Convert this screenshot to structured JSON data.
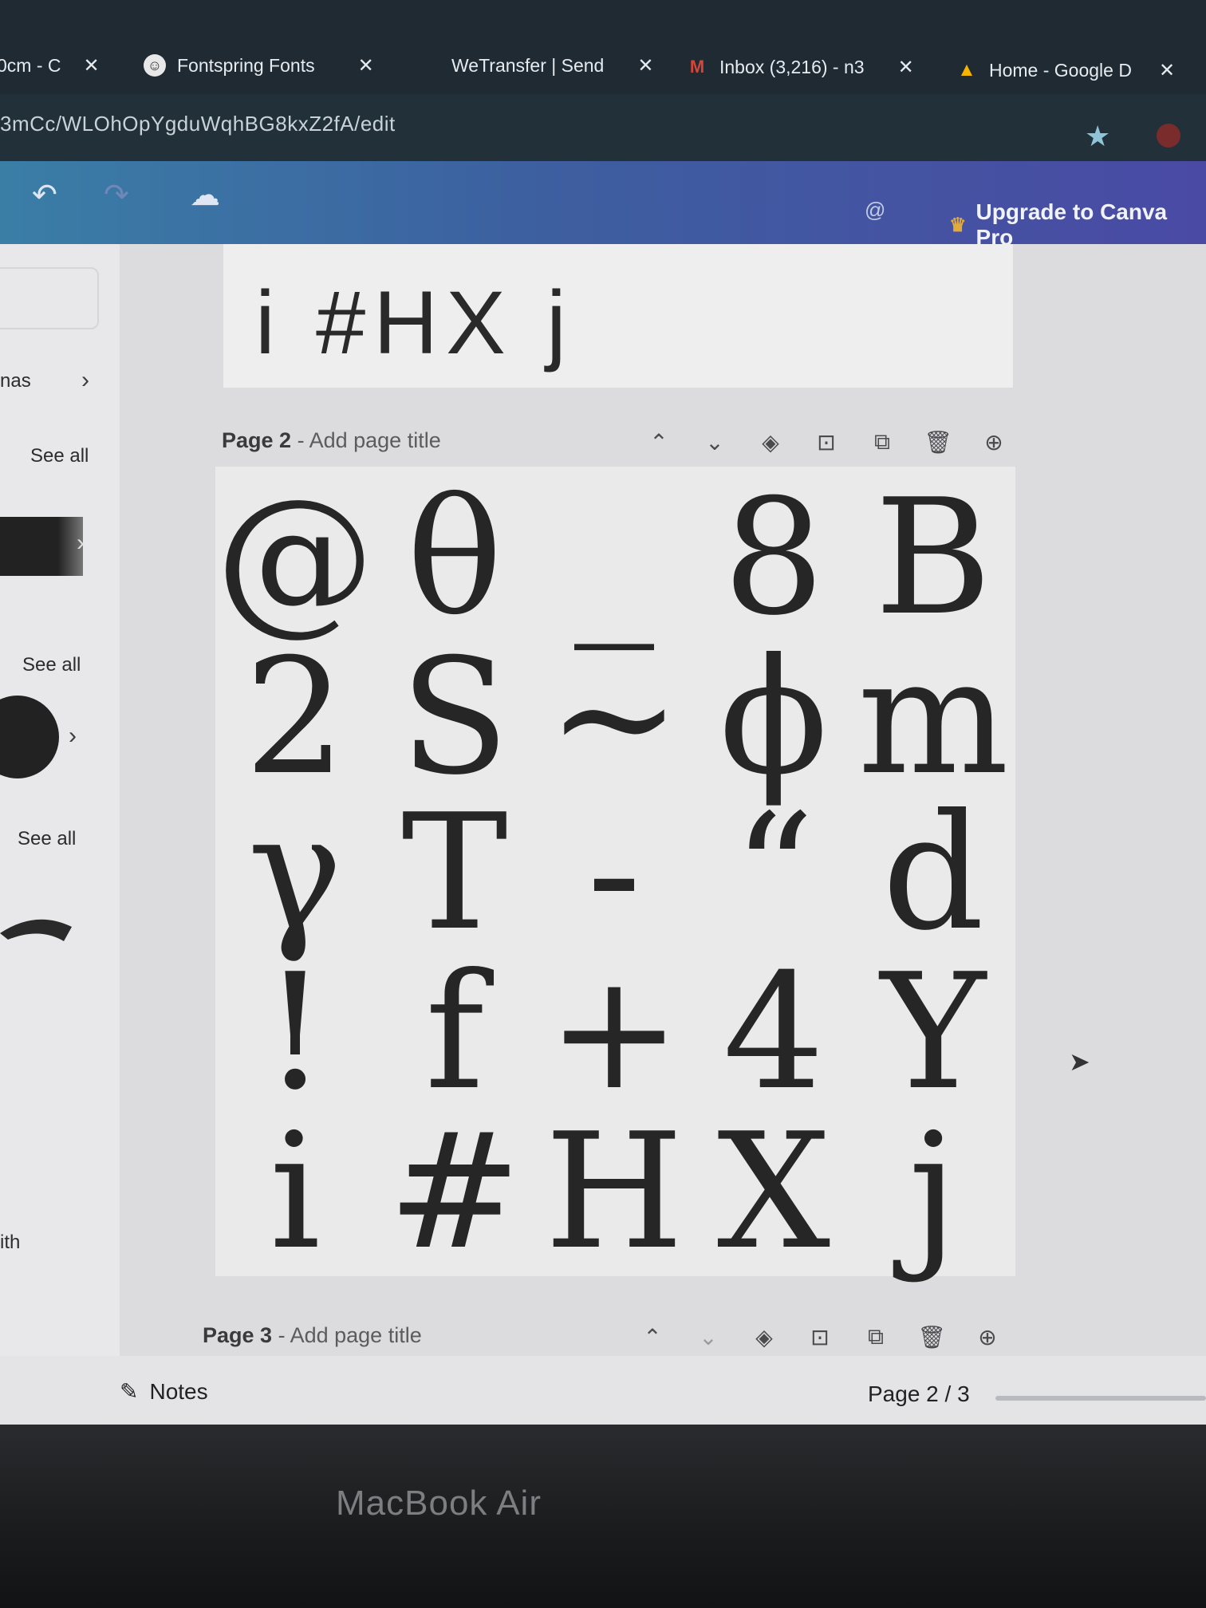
{
  "browser": {
    "tabs": [
      {
        "label": "0cm - C",
        "icon": "doc-icon",
        "icon_color": "#9aa7b2"
      },
      {
        "label": "Fontspring Fonts",
        "icon": "fontspring-icon",
        "icon_color": "#e8e8e8"
      },
      {
        "label": "WeTransfer | Send",
        "icon": "none",
        "icon_color": "#1f2a33"
      },
      {
        "label": "Inbox (3,216) - n3",
        "icon": "gmail-icon",
        "icon_color": "#d44638"
      },
      {
        "label": "Home - Google D",
        "icon": "drive-icon",
        "icon_color": "#f4b400"
      }
    ],
    "close_glyph": "✕",
    "address": "3mCc/WLOhOpYgduWqhBG8kxZ2fA/edit",
    "star_glyph": "★"
  },
  "toolbar": {
    "undo_glyph": "↶",
    "redo_glyph": "↷",
    "save_glyph": "☁",
    "at_glyph": "@",
    "crown_glyph": "♛",
    "upgrade_label": "Upgrade to Canva Pro",
    "accent": "#3d5fa0"
  },
  "left_panel": {
    "fragment_label": "nas",
    "see_all_1": "See all",
    "see_all_2": "See all",
    "see_all_3": "See all",
    "fragment_bottom": "ith",
    "chevron": "›"
  },
  "page1": {
    "glyphs": "i #HX j"
  },
  "page2_header": {
    "page_label": "Page 2",
    "title_placeholder": "- Add page title"
  },
  "page3_header": {
    "page_label": "Page 3",
    "title_placeholder": "- Add page title"
  },
  "page_actions": {
    "up": "⌃",
    "down": "⌄",
    "hide": "◈",
    "lock": "⊡",
    "duplicate": "⧉",
    "delete": "🗑",
    "add": "⊕"
  },
  "glyph_grid": [
    [
      "@",
      "θ",
      "_",
      "8",
      "B"
    ],
    [
      "2",
      "S",
      "~",
      "ϕ",
      "m"
    ],
    [
      "γ",
      "T",
      "-",
      "“",
      "d"
    ],
    [
      "!",
      "f",
      "+",
      "4",
      "Y"
    ],
    [
      "i",
      "#",
      "H",
      "X",
      "j"
    ]
  ],
  "footer": {
    "notes_label": "Notes",
    "notes_glyph": "✎",
    "page_count": "Page 2 / 3"
  },
  "laptop": {
    "brand": "MacBook Air"
  }
}
